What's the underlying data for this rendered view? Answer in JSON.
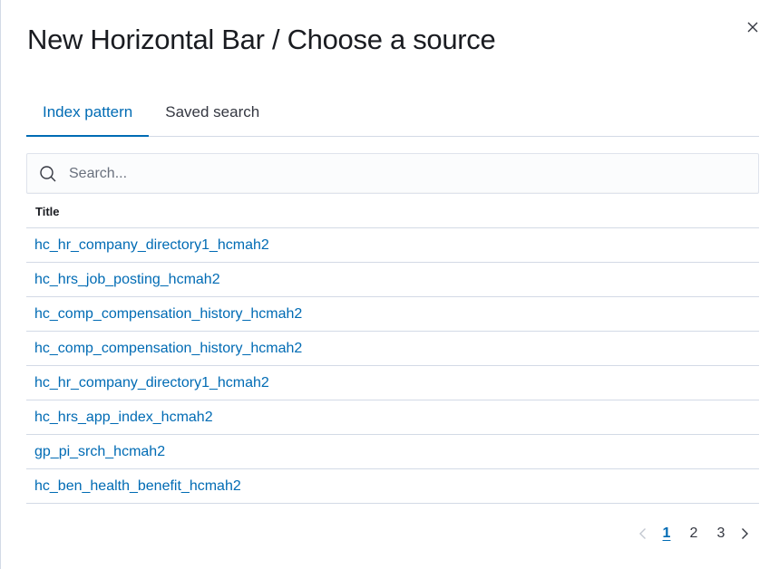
{
  "modal": {
    "title": "New Horizontal Bar / Choose a source"
  },
  "tabs": [
    {
      "label": "Index pattern",
      "selected": true
    },
    {
      "label": "Saved search",
      "selected": false
    }
  ],
  "search": {
    "placeholder": "Search...",
    "value": ""
  },
  "table": {
    "column_header": "Title",
    "rows": [
      "hc_hr_company_directory1_hcmah2",
      "hc_hrs_job_posting_hcmah2",
      "hc_comp_compensation_history_hcmah2",
      "hc_comp_compensation_history_hcmah2",
      "hc_hr_company_directory1_hcmah2",
      "hc_hrs_app_index_hcmah2",
      "gp_pi_srch_hcmah2",
      "hc_ben_health_benefit_hcmah2"
    ]
  },
  "pagination": {
    "pages": [
      "1",
      "2",
      "3"
    ],
    "current": "1"
  },
  "colors": {
    "link": "#006bb4",
    "text": "#343741",
    "border": "#d3dae6"
  },
  "icons": {
    "close": "close-icon",
    "search": "search-icon",
    "prev": "chevron-left-icon",
    "next": "chevron-right-icon"
  }
}
